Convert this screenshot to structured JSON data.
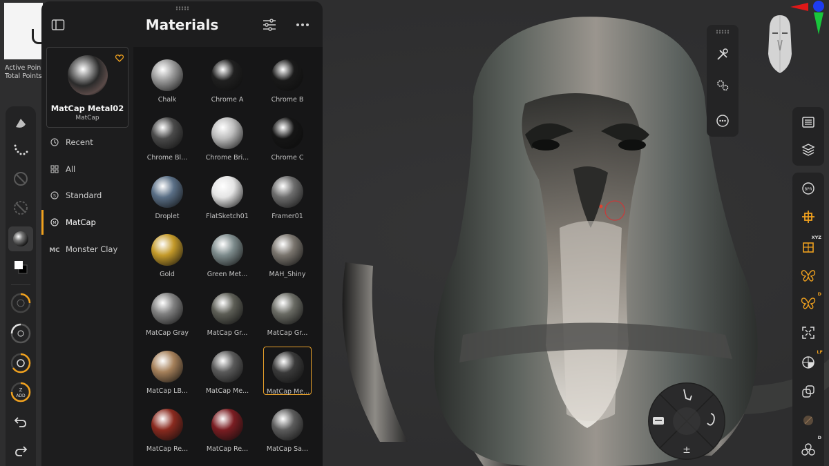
{
  "stats": {
    "active_points": "Active Poin",
    "total_points": "Total Points"
  },
  "panel": {
    "title": "Materials",
    "current": {
      "name": "MatCap Metal02",
      "category": "MatCap"
    },
    "nav": [
      {
        "label": "Recent",
        "icon": "clock-icon",
        "active": false
      },
      {
        "label": "All",
        "icon": "grid-icon",
        "active": false
      },
      {
        "label": "Standard",
        "icon": "standard-s-icon",
        "active": false
      },
      {
        "label": "MatCap",
        "icon": "matcap-m-icon",
        "active": true
      },
      {
        "label": "Monster Clay",
        "icon": "monster-clay-icon",
        "active": false
      }
    ],
    "materials": [
      {
        "label": "Chalk",
        "color": "#9a9a9a"
      },
      {
        "label": "Chrome A",
        "color": "#202020"
      },
      {
        "label": "Chrome B",
        "color": "#1a1a1a"
      },
      {
        "label": "Chrome Bl...",
        "color": "#4a4a4a"
      },
      {
        "label": "Chrome Bri...",
        "color": "#bcbcbc"
      },
      {
        "label": "Chrome C",
        "color": "#151515"
      },
      {
        "label": "Droplet",
        "color": "#5a6f86"
      },
      {
        "label": "FlatSketch01",
        "color": "#e4e4e4"
      },
      {
        "label": "Framer01",
        "color": "#6d6d6d"
      },
      {
        "label": "Gold",
        "color": "#c49a2a"
      },
      {
        "label": "Green Met...",
        "color": "#7d8b8c"
      },
      {
        "label": "MAH_Shiny",
        "color": "#7a756e"
      },
      {
        "label": "MatCap Gray",
        "color": "#808080"
      },
      {
        "label": "MatCap Gr...",
        "color": "#5d5e56"
      },
      {
        "label": "MatCap Gr...",
        "color": "#6a6b64"
      },
      {
        "label": "MatCap LB...",
        "color": "#a5805a"
      },
      {
        "label": "MatCap Me...",
        "color": "#5a5a5a"
      },
      {
        "label": "MatCap Me...",
        "color": "#3a3a3a",
        "selected": true
      },
      {
        "label": "MatCap Re...",
        "color": "#8a2a1f"
      },
      {
        "label": "MatCap Re...",
        "color": "#7a1d22"
      },
      {
        "label": "MatCap Sa...",
        "color": "#5c5c5c"
      }
    ]
  },
  "right_badges": {
    "xyz": "XYZ",
    "d1": "D",
    "lf": "LF",
    "d2": "D"
  },
  "left_badges": {
    "z_add": "Z\nADD"
  },
  "colors": {
    "accent": "#f0a11e",
    "panel_bg": "#1d1d1e",
    "grid_bg": "#161617"
  }
}
